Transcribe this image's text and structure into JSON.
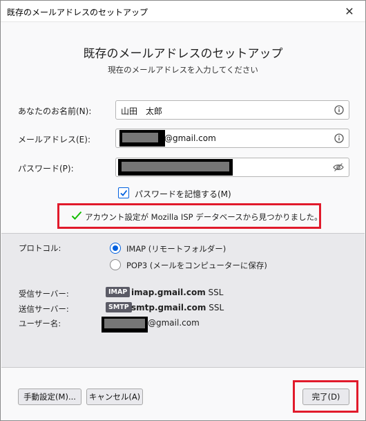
{
  "window": {
    "title": "既存のメールアドレスのセットアップ",
    "close_glyph": "✕"
  },
  "header": {
    "heading": "既存のメールアドレスのセットアップ",
    "subheading": "現在のメールアドレスを入力してください"
  },
  "form": {
    "name_label": "あなたのお名前(N):",
    "name_value": "山田　太郎",
    "email_label": "メールアドレス(E):",
    "email_suffix": "@gmail.com",
    "password_label": "パスワード(P):",
    "remember_label": "パスワードを記憶する(M)",
    "remember_checked": true
  },
  "notice": {
    "message": "アカウント設定が Mozilla ISP データベースから見つかりました。"
  },
  "config": {
    "protocol_label": "プロトコル:",
    "protocols": [
      {
        "label": "IMAP (リモートフォルダー)",
        "selected": true
      },
      {
        "label": "POP3 (メールをコンピューターに保存)",
        "selected": false
      }
    ],
    "incoming_label": "受信サーバー:",
    "incoming_tag": "IMAP",
    "incoming_host": "imap.gmail.com",
    "incoming_security": "SSL",
    "outgoing_label": "送信サーバー:",
    "outgoing_tag": "SMTP",
    "outgoing_host": "smtp.gmail.com",
    "outgoing_security": "SSL",
    "username_label": "ユーザー名:",
    "username_suffix": "@gmail.com"
  },
  "buttons": {
    "manual": "手動設定(M)...",
    "cancel": "キャンセル(A)",
    "done": "完了(D)"
  },
  "colors": {
    "accent": "#0060df",
    "highlight_frame": "#e11a2b",
    "success": "#12bc00",
    "tag_bg": "#5b5b66"
  }
}
